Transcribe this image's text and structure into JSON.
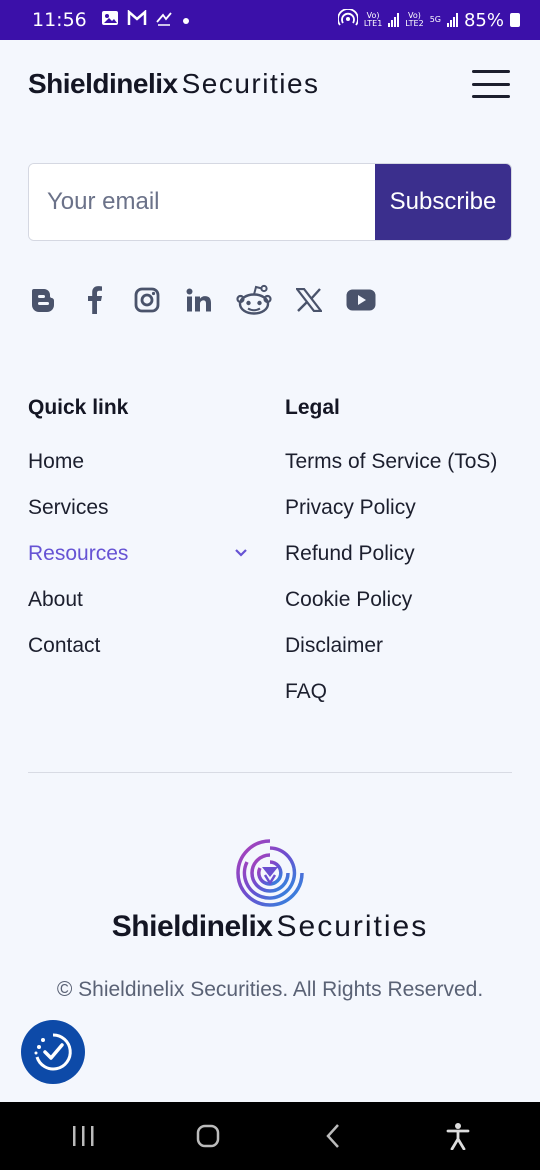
{
  "status_bar": {
    "time": "11:56",
    "battery": "85%",
    "sim1_label_top": "Vo)",
    "sim1_label_bottom": "LTE1",
    "sim2_label_top": "Vo)",
    "sim2_label_bottom": "LTE2",
    "network": "5G",
    "icons": [
      "gallery-icon",
      "gmail-icon",
      "missed-call-icon",
      "dot-icon",
      "hotspot-icon",
      "signal-icon",
      "battery-icon"
    ]
  },
  "header": {
    "brand_bold": "Shieldinelix",
    "brand_light": "Securities",
    "menu_icon": "hamburger-icon"
  },
  "subscribe": {
    "placeholder": "Your email",
    "value": "",
    "button_label": "Subscribe"
  },
  "social": [
    "blogger-icon",
    "facebook-icon",
    "instagram-icon",
    "linkedin-icon",
    "reddit-icon",
    "x-icon",
    "youtube-icon"
  ],
  "quick_links": {
    "heading": "Quick link",
    "items": [
      {
        "label": "Home"
      },
      {
        "label": "Services"
      },
      {
        "label": "Resources"
      },
      {
        "label": "About"
      },
      {
        "label": "Contact"
      }
    ],
    "active_color": "#6653d4"
  },
  "legal": {
    "heading": "Legal",
    "items": [
      {
        "label": "Terms of Service (ToS)"
      },
      {
        "label": "Privacy Policy"
      },
      {
        "label": "Refund Policy"
      },
      {
        "label": "Cookie Policy"
      },
      {
        "label": "Disclaimer"
      },
      {
        "label": "FAQ"
      }
    ]
  },
  "footer": {
    "brand_bold": "Shieldinelix",
    "brand_light": "Securities",
    "copyright": "© Shieldinelix Securities. All Rights Reserved."
  },
  "colors": {
    "status_bar": "#3b10a9",
    "accent": "#3b2f8d",
    "link_active": "#6653d4",
    "a11y_button": "#0d4aa8",
    "background": "#f4f7fd"
  }
}
